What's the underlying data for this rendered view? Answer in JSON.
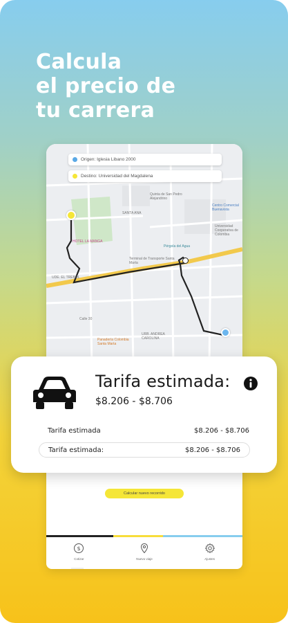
{
  "headline": {
    "line1": "Calcula",
    "line2": "el precio de",
    "line3": "tu carrera"
  },
  "map": {
    "origin_label": "Origen: Iglesia Libano 2000",
    "destination_label": "Destino: Universidad del Magdalena",
    "origin_color": "#5aa9e6",
    "destination_color": "#f5e637",
    "route_color": "#222222",
    "road_color": "#f2c94c",
    "poi_labels": {
      "santa_ana": "SANTA ANA",
      "hotel": "HOTEL LA MANGA",
      "terminal": "Terminal de Transporte Santa Marta",
      "pergola": "Pérgola del Agua",
      "udea": "UDE. EL TREBOL",
      "andrea": "URB. ANDREA CAROLINA",
      "panaderia": "Panadería Colombia Santa Marta",
      "centro": "Centro Comercial Buenavista",
      "universidad": "Universidad Cooperativa de Colombia",
      "quinta": "Quinta de San Pedro Alejandrino",
      "calle": "Calle 30"
    }
  },
  "fare_card": {
    "title": "Tarifa estimada:",
    "range": "$8.206 - $8.706",
    "rows": [
      {
        "label": "Tarifa estimada",
        "value": "$8.206 - $8.706"
      },
      {
        "label": "Tarifa estimada:",
        "value": "$8.206 - $8.706"
      }
    ]
  },
  "calc_button": {
    "label": "Calcular nuevo recorrido"
  },
  "tabs": [
    {
      "label": "Cotizar",
      "icon": "dollar-icon"
    },
    {
      "label": "Nuevo viaje",
      "icon": "map-pin-icon"
    },
    {
      "label": "Ajustes",
      "icon": "gear-icon"
    }
  ],
  "colors": {
    "accent_yellow": "#f5e637",
    "progress_dark": "#222222",
    "progress_yellow": "#f7dd3a",
    "progress_blue": "#87cdee"
  }
}
